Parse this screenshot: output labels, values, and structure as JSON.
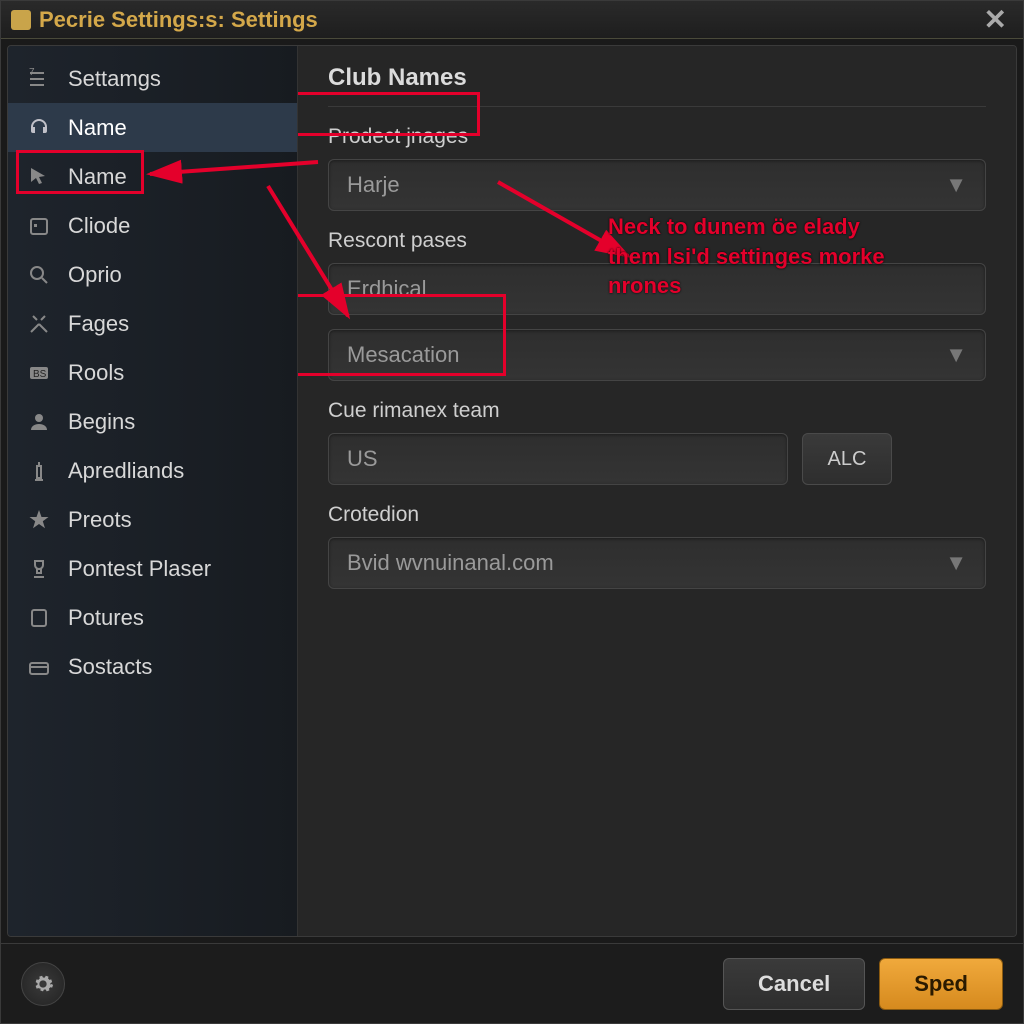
{
  "title": "Pecrie Settings:s: Settings",
  "sidebar": {
    "items": [
      {
        "label": "Settamgs",
        "icon": "sliders"
      },
      {
        "label": "Name",
        "icon": "headset",
        "active": true
      },
      {
        "label": "Name",
        "icon": "cursor"
      },
      {
        "label": "Cliode",
        "icon": "calendar"
      },
      {
        "label": "Oprio",
        "icon": "magnify"
      },
      {
        "label": "Fages",
        "icon": "swords"
      },
      {
        "label": "Rools",
        "icon": "bs"
      },
      {
        "label": "Begins",
        "icon": "person"
      },
      {
        "label": "Apredliands",
        "icon": "candle"
      },
      {
        "label": "Preots",
        "icon": "star"
      },
      {
        "label": "Pontest Plaser",
        "icon": "trophy"
      },
      {
        "label": "Potures",
        "icon": "device"
      },
      {
        "label": "Sostacts",
        "icon": "chest"
      }
    ]
  },
  "main": {
    "section_title": "Club Names",
    "field1_label": "Prodect jnages",
    "field1_value": "Harje",
    "field2_label": "Rescont pases",
    "field2a_value": "Erdhical",
    "field2b_value": "Mesacation",
    "field3_label": "Cue rimanex team",
    "field3_value": "US",
    "field3_btn": "ALC",
    "field4_label": "Crotedion",
    "field4_value": "Bvid wvnuinanal.com"
  },
  "footer": {
    "cancel": "Cancel",
    "save": "Sped"
  },
  "annotations": {
    "text": "Neck to dunem öe elady them lsi'd settinges morke nrones"
  }
}
